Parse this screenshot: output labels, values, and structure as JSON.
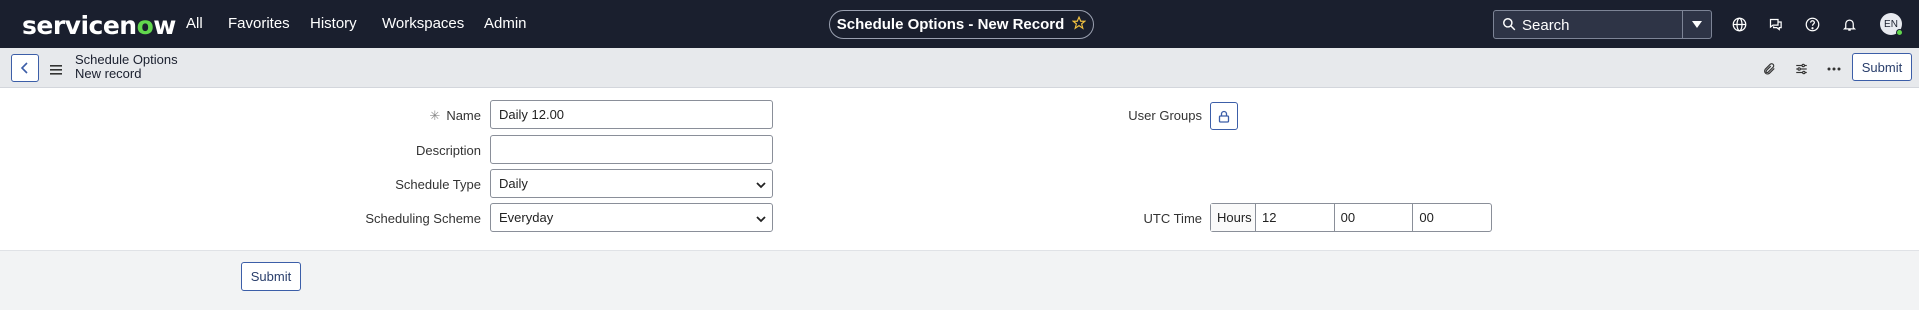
{
  "nav": {
    "logo": {
      "prefix": "servicen",
      "o": "o",
      "suffix": "w"
    },
    "items": [
      {
        "label": "All"
      },
      {
        "label": "Favorites"
      },
      {
        "label": "History"
      },
      {
        "label": "Workspaces"
      },
      {
        "label": "Admin"
      }
    ],
    "page_title": "Schedule Options - New Record",
    "search_label": "Search",
    "avatar_initials": "EN",
    "icons": [
      "globe-icon",
      "chat-icon",
      "help-icon",
      "bell-icon"
    ]
  },
  "record_header": {
    "table_name": "Schedule Options",
    "record_state": "New record",
    "submit_label": "Submit"
  },
  "form": {
    "name": {
      "label": "Name",
      "value": "Daily 12.00",
      "required": true
    },
    "description": {
      "label": "Description",
      "value": ""
    },
    "schedule_type": {
      "label": "Schedule Type",
      "value": "Daily"
    },
    "scheduling_scheme": {
      "label": "Scheduling Scheme",
      "value": "Everyday"
    },
    "user_groups": {
      "label": "User Groups"
    },
    "utc_time": {
      "label": "UTC Time",
      "unit": "Hours",
      "hours": "12",
      "minutes": "00",
      "seconds": "00"
    }
  },
  "footer": {
    "submit_label": "Submit"
  },
  "colors": {
    "nav_bg": "#1a1f2e",
    "accent": "#62d84e",
    "button_border": "#3c5ea8"
  }
}
